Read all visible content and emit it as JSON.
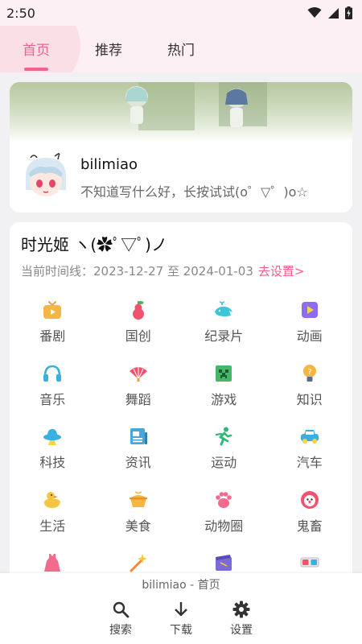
{
  "status_bar": {
    "time": "2:50",
    "icons": [
      "wifi-icon",
      "cellular-signal-icon",
      "battery-charging-icon"
    ]
  },
  "top_tabs": {
    "tabs": [
      {
        "label": "首页",
        "active": true
      },
      {
        "label": "推荐",
        "active": false
      },
      {
        "label": "热门",
        "active": false
      }
    ]
  },
  "profile": {
    "name": "bilimiao",
    "signature": "不知道写什么好，长按试试(o゜▽゜)o☆"
  },
  "main": {
    "title": "时光姬 ヽ(✿ﾟ▽ﾟ)ノ",
    "timeline_label": "当前时间线：2023-12-27 至 2024-01-03",
    "timeline_link": "去设置>",
    "categories": [
      {
        "label": "番剧",
        "icon": "tv-icon"
      },
      {
        "label": "国创",
        "icon": "gourd-icon"
      },
      {
        "label": "纪录片",
        "icon": "whale-icon"
      },
      {
        "label": "动画",
        "icon": "play-box-icon"
      },
      {
        "label": "音乐",
        "icon": "headphones-icon"
      },
      {
        "label": "舞蹈",
        "icon": "fan-icon"
      },
      {
        "label": "游戏",
        "icon": "creeper-icon"
      },
      {
        "label": "知识",
        "icon": "lightbulb-icon"
      },
      {
        "label": "科技",
        "icon": "ufo-icon"
      },
      {
        "label": "资讯",
        "icon": "newspaper-icon"
      },
      {
        "label": "运动",
        "icon": "runner-icon"
      },
      {
        "label": "汽车",
        "icon": "car-icon"
      },
      {
        "label": "生活",
        "icon": "duck-icon"
      },
      {
        "label": "美食",
        "icon": "cooking-pot-icon"
      },
      {
        "label": "动物圈",
        "icon": "paw-icon"
      },
      {
        "label": "鬼畜",
        "icon": "clown-icon"
      },
      {
        "label": "",
        "icon": "dress-icon"
      },
      {
        "label": "",
        "icon": "magic-wand-icon"
      },
      {
        "label": "",
        "icon": "film-clap-icon"
      },
      {
        "label": "",
        "icon": "3d-glasses-icon"
      }
    ]
  },
  "bottom_nav": {
    "caption": "bilimiao - 首页",
    "items": [
      {
        "label": "搜索",
        "icon": "search-icon"
      },
      {
        "label": "下载",
        "icon": "download-icon"
      },
      {
        "label": "设置",
        "icon": "gear-icon"
      }
    ]
  },
  "colors": {
    "accent": "#f5608c",
    "tab_bar_bg": "#fdf0f4",
    "page_bg": "#f1f1f3"
  }
}
